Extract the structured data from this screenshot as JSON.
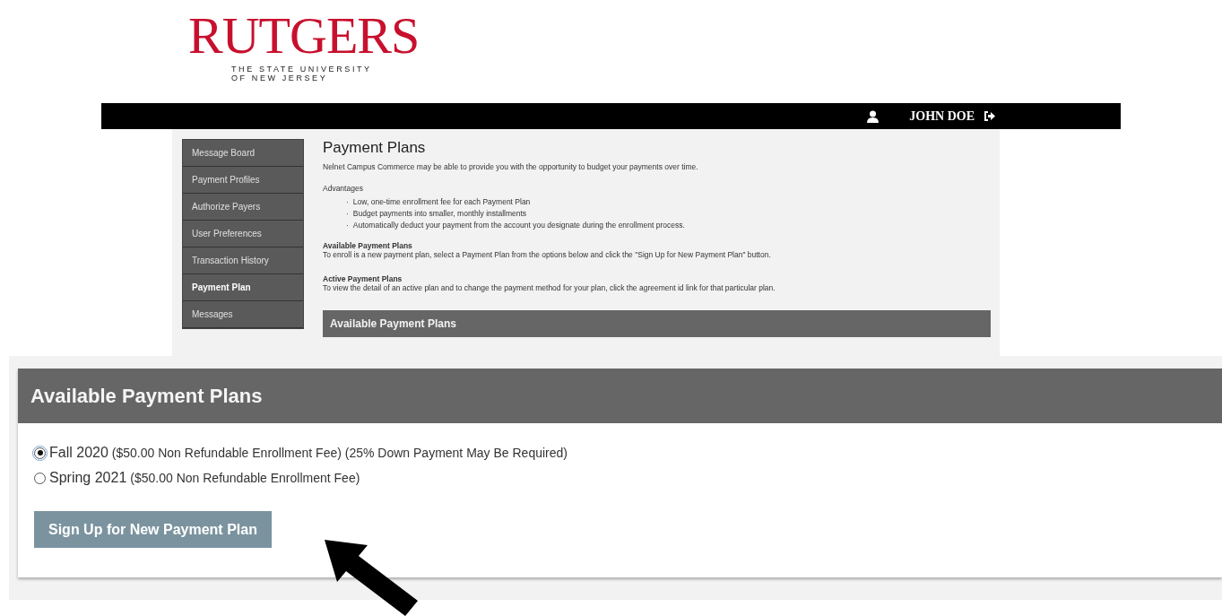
{
  "logo": {
    "wordmark": "RUTGERS",
    "tagline_1": "THE STATE UNIVERSITY",
    "tagline_2": "OF NEW JERSEY"
  },
  "header": {
    "user_name": "JOHN DOE"
  },
  "sidebar": {
    "items": [
      {
        "label": "Message Board",
        "selected": false
      },
      {
        "label": "Payment Profiles",
        "selected": false
      },
      {
        "label": "Authorize Payers",
        "selected": false
      },
      {
        "label": "User Preferences",
        "selected": false
      },
      {
        "label": "Transaction History",
        "selected": false
      },
      {
        "label": "Payment Plan",
        "selected": true
      },
      {
        "label": "Messages",
        "selected": false
      }
    ]
  },
  "content": {
    "title": "Payment Plans",
    "intro": "Nelnet Campus Commerce may be able to provide you with the opportunity to budget your payments over time.",
    "advantages_heading": "Advantages",
    "advantages": [
      {
        "marker": "·",
        "text": "Low, one-time enrollment fee for each Payment Plan"
      },
      {
        "marker": "·",
        "text": "Budget payments into smaller, monthly installments"
      },
      {
        "marker": "·",
        "text": "Automatically deduct your payment from the account you designate during the enrollment process."
      }
    ],
    "sections": [
      {
        "heading": "Available Payment Plans",
        "text": "To enroll is a new payment plan, select a Payment Plan from the options below and click the \"Sign Up for New Payment Plan\" button."
      },
      {
        "heading": "Active Payment Plans",
        "text": "To view the detail of an active plan and to change the payment method for your plan, click the agreement id link for that particular plan."
      }
    ],
    "panel_title": "Available Payment Plans"
  },
  "zoomed_panel": {
    "title": "Available Payment Plans",
    "plans": [
      {
        "term": "Fall 2020",
        "detail": "($50.00 Non Refundable Enrollment Fee) (25% Down Payment May Be Required)",
        "selected": true
      },
      {
        "term": "Spring 2021",
        "detail": "($50.00 Non Refundable Enrollment Fee)",
        "selected": false
      }
    ],
    "button": "Sign Up for New Payment Plan"
  }
}
